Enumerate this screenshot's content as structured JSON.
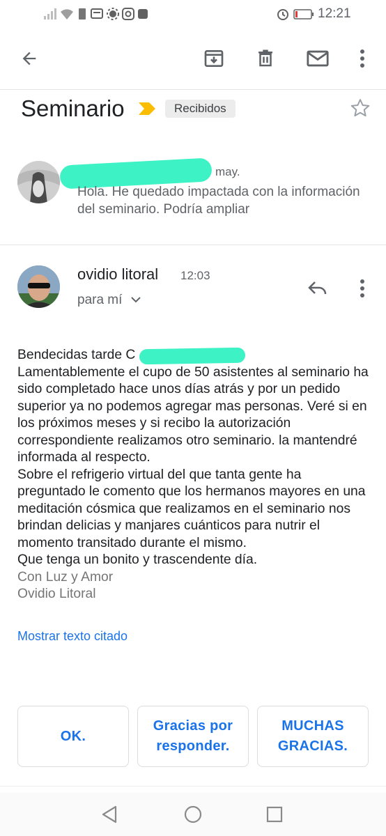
{
  "status_bar": {
    "time": "12:21"
  },
  "toolbar": {
    "back": "back-arrow-icon",
    "archive": "archive-icon",
    "delete": "trash-icon",
    "mark_unread": "mail-icon",
    "more": "more-vert-icon"
  },
  "thread": {
    "subject": "Seminario",
    "label": "Recibidos",
    "colors": {
      "important_marker": "#fbbc04",
      "accent": "#1a73e8",
      "redaction": "#3df2c4"
    }
  },
  "collapsed_message": {
    "date": "may.",
    "snippet": "Hola. He quedado impactada con la información del seminario. Podría ampliar"
  },
  "message": {
    "sender": "ovidio litoral",
    "time": "12:03",
    "recipient": "para mí",
    "body": [
      "Bendecidas tarde C",
      "Lamentablemente el cupo de 50 asistentes al seminario ha sido completado hace unos días atrás y por un pedido superior ya no podemos agregar mas personas. Veré si en los próximos meses y si recibo la autorización correspondiente realizamos otro seminario. la mantendré informada al respecto.",
      "Sobre el refrigerio virtual del que tanta gente ha preguntado le comento que los hermanos mayores en una meditación cósmica que realizamos en el seminario nos brindan delicias y manjares cuánticos para nutrir el momento transitado durante el mismo.",
      "Que tenga un bonito y trascendente día."
    ],
    "signature": [
      "Con Luz y Amor",
      "Ovidio Litoral"
    ],
    "show_quoted": "Mostrar texto citado"
  },
  "smart_replies": [
    "OK.",
    "Gracias por responder.",
    "MUCHAS GRACIAS."
  ]
}
